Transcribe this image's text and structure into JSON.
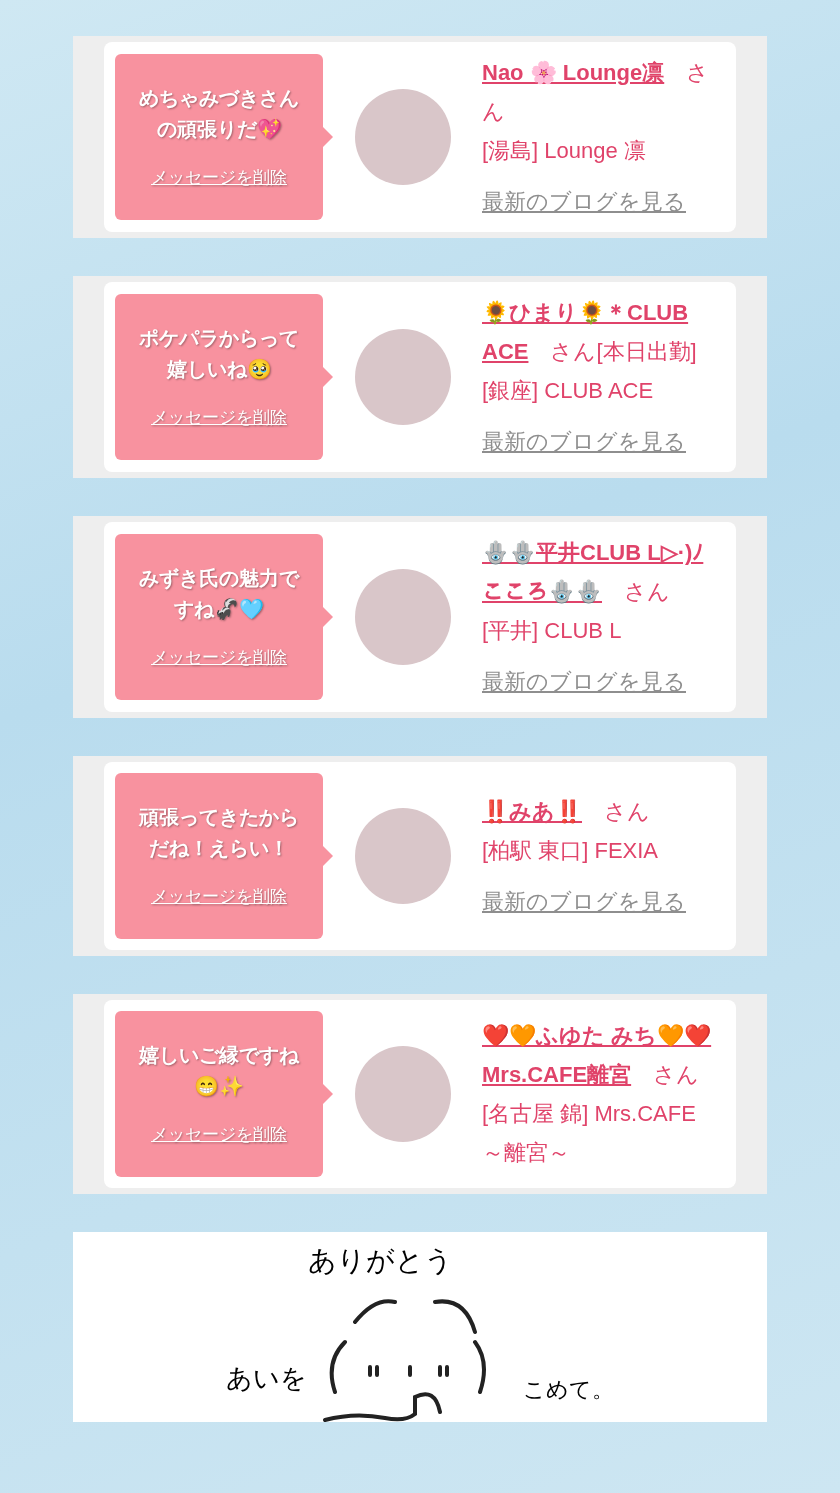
{
  "cards": [
    {
      "message": "めちゃみづきさんの頑張りだ💖",
      "delete_link": "メッセージを削除",
      "name": "Nao 🌸 Lounge凛",
      "suffix": "さん",
      "location": "[湯島] Lounge 凛",
      "blog_link": "最新のブログを見る"
    },
    {
      "message": "ポケパラからって嬉しいね🥹",
      "delete_link": "メッセージを削除",
      "name": "🌻ひまり🌻＊CLUB ACE",
      "suffix": "さん[本日出勤]",
      "location": "[銀座] CLUB ACE",
      "blog_link": "最新のブログを見る"
    },
    {
      "message": "みずき氏の魅力ですね🦨🩵",
      "delete_link": "メッセージを削除",
      "name": "🪬🪬平井CLUB L▷·)ﾉこころ🪬🪬",
      "suffix": "さん",
      "location": "[平井] CLUB L",
      "blog_link": "最新のブログを見る"
    },
    {
      "message": "頑張ってきたからだね！えらい！",
      "delete_link": "メッセージを削除",
      "name": "‼️みあ‼️",
      "suffix": "さん",
      "location": "[柏駅 東口] FEXIA",
      "blog_link": "最新のブログを見る"
    },
    {
      "message": "嬉しいご縁ですね😁✨",
      "delete_link": "メッセージを削除",
      "name": "❤️🧡ふゆた みち🧡❤️Mrs.CAFE離宮",
      "suffix": "さん",
      "location": "[名古屋 錦] Mrs.CAFE ～離宮～"
    }
  ],
  "handwritten_note": {
    "top": "ありがとう",
    "left": "あいを",
    "right": "こめて。"
  }
}
